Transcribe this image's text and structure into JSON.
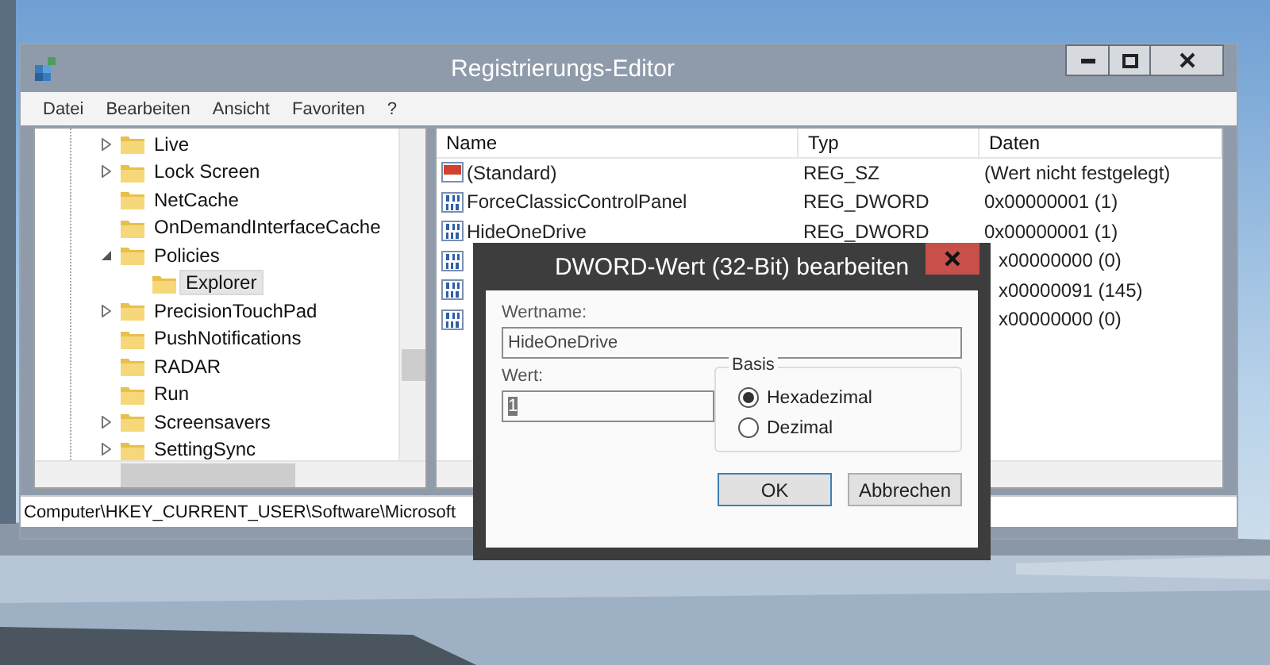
{
  "window": {
    "title": "Registrierungs-Editor"
  },
  "menu": [
    "Datei",
    "Bearbeiten",
    "Ansicht",
    "Favoriten",
    "?"
  ],
  "tree": [
    {
      "label": "Live",
      "expanded": false,
      "selected": false
    },
    {
      "label": "Lock Screen",
      "expanded": false,
      "selected": false
    },
    {
      "label": "NetCache",
      "selected": false
    },
    {
      "label": "OnDemandInterfaceCache",
      "selected": false
    },
    {
      "label": "Policies",
      "expanded": true,
      "selected": false,
      "children": [
        {
          "label": "Explorer",
          "selected": true
        }
      ]
    },
    {
      "label": "PrecisionTouchPad",
      "expanded": false,
      "selected": false
    },
    {
      "label": "PushNotifications",
      "selected": false
    },
    {
      "label": "RADAR",
      "selected": false
    },
    {
      "label": "Run",
      "selected": false
    },
    {
      "label": "Screensavers",
      "expanded": false,
      "selected": false
    },
    {
      "label": "SettingSync",
      "expanded": false,
      "selected": false
    }
  ],
  "table": {
    "columns": [
      "Name",
      "Typ",
      "Daten"
    ],
    "rows": [
      {
        "kind": "string",
        "name": "(Standard)",
        "type": "REG_SZ",
        "data": "(Wert nicht festgelegt)"
      },
      {
        "kind": "dword",
        "name": "ForceClassicControlPanel",
        "type": "REG_DWORD",
        "data": "0x00000001 (1)"
      },
      {
        "kind": "dword",
        "name": "HideOneDrive",
        "type": "REG_DWORD",
        "data": "0x00000001 (1)"
      },
      {
        "kind": "dword",
        "data": "x00000000 (0)"
      },
      {
        "kind": "dword",
        "data": "x00000091 (145)"
      },
      {
        "kind": "dword",
        "data": "x00000000 (0)"
      }
    ]
  },
  "status_bar": "Computer\\HKEY_CURRENT_USER\\Software\\Microsoft",
  "dialog": {
    "title": "DWORD-Wert (32-Bit) bearbeiten",
    "name_label": "Wertname:",
    "name_value": "HideOneDrive",
    "value_label": "Wert:",
    "value_value": "1",
    "base_label": "Basis",
    "bases": [
      {
        "label": "Hexadezimal",
        "selected": true
      },
      {
        "label": "Dezimal",
        "selected": false
      }
    ],
    "buttons": [
      {
        "label": "OK",
        "kind": "default"
      },
      {
        "label": "Abbrechen",
        "kind": "normal"
      }
    ]
  }
}
